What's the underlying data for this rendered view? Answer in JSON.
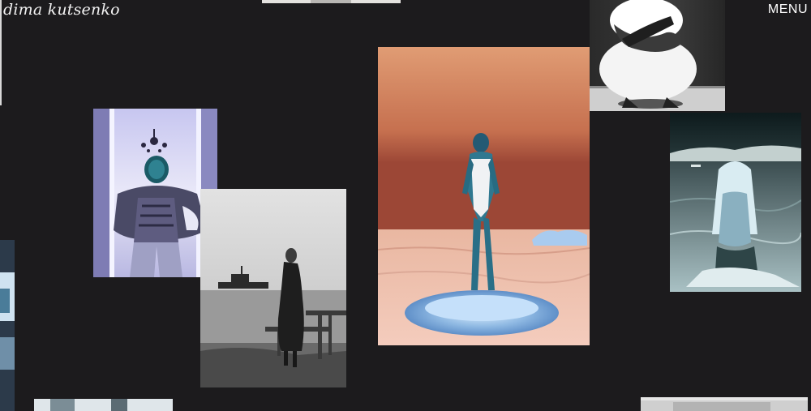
{
  "header": {
    "logo_text": "dima kutsenko",
    "menu_label": "MENU"
  },
  "gallery": {
    "photos": [
      {
        "id": "top-strip-photo",
        "subject": "partially visible photo strip"
      },
      {
        "id": "crouching-figure-photo",
        "subject": "inverted figure crouching with crossed arms"
      },
      {
        "id": "chandelier-figure-photo",
        "subject": "inverted figure in corridor under chandelier"
      },
      {
        "id": "pier-woman-photo",
        "subject": "woman standing on pier by sea with boat"
      },
      {
        "id": "iceberg-figure-photo",
        "subject": "figure in swimsuit standing on ice floe, orange sky"
      },
      {
        "id": "sea-blonde-photo",
        "subject": "blonde figure seated in sea water, inverted"
      },
      {
        "id": "left-edge-photo",
        "subject": "partially visible inverted photo"
      },
      {
        "id": "bottom-left-photo",
        "subject": "partially visible photo"
      },
      {
        "id": "bottom-right-photo",
        "subject": "partially visible grey photo"
      }
    ]
  },
  "colors": {
    "background": "#1c1b1d",
    "text": "#f3f3f3"
  }
}
